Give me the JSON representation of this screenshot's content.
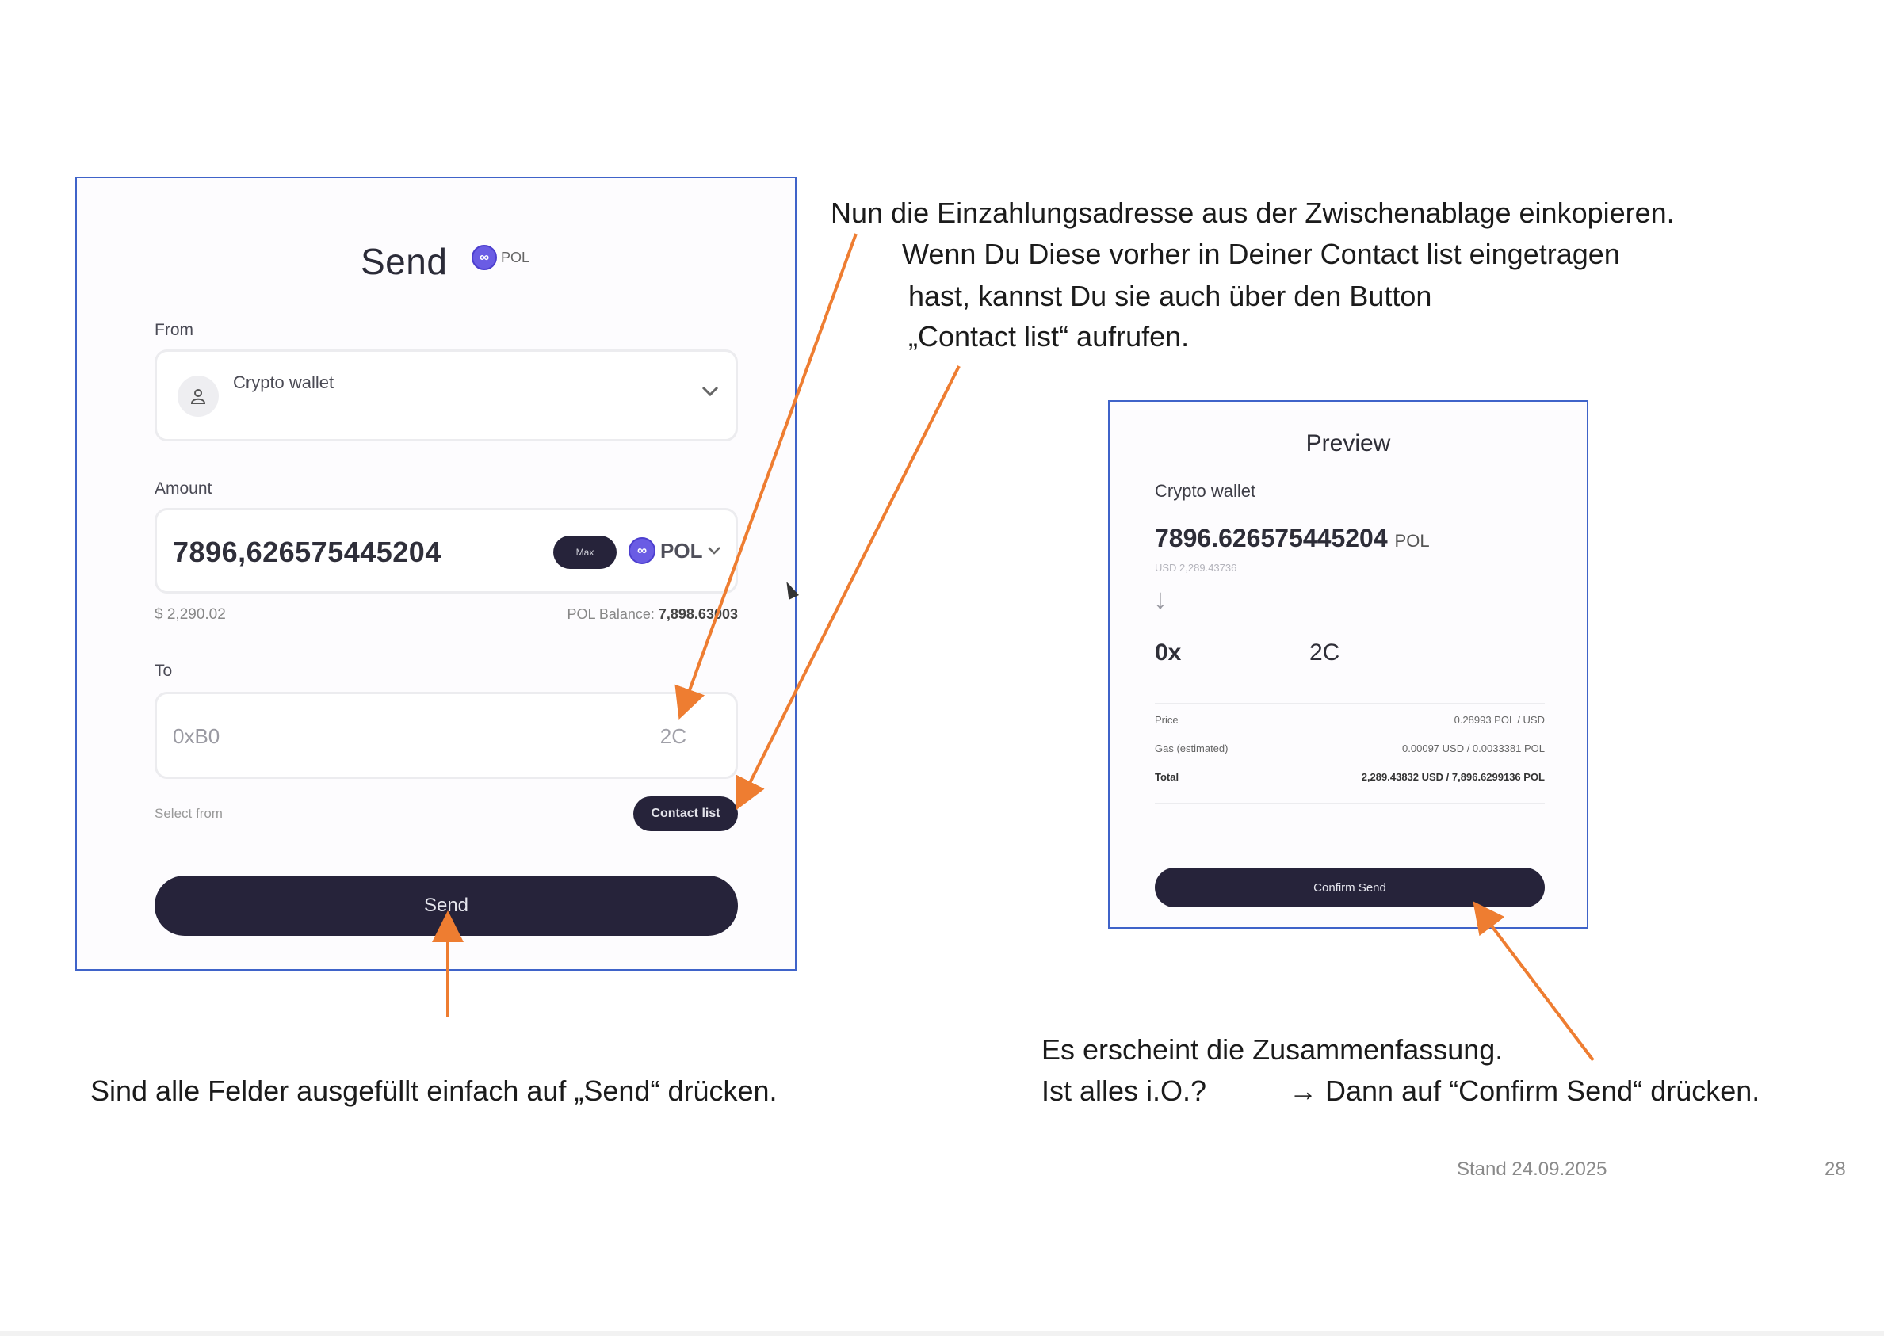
{
  "send_panel": {
    "title": "Send",
    "token": "POL",
    "token_icon": "polygon-icon",
    "from": {
      "label": "From",
      "wallet_name": "Crypto wallet"
    },
    "amount": {
      "label": "Amount",
      "value": "7896,626575445204",
      "max_label": "Max",
      "token": "POL",
      "usd_value": "$ 2,290.02",
      "balance_label": "POL Balance:",
      "balance_value": "7,898.63003"
    },
    "to": {
      "label": "To",
      "address_start": "0xB0",
      "address_end": "2C",
      "select_from_label": "Select from",
      "contact_button_label": "Contact list"
    },
    "send_button_label": "Send"
  },
  "preview_panel": {
    "title": "Preview",
    "wallet_name": "Crypto wallet",
    "amount_value": "7896.626575445204",
    "amount_unit": "POL",
    "usd_value": "USD 2,289.43736",
    "direction_arrow": "↓",
    "address_start": "0x",
    "address_end": "2C",
    "rows": [
      {
        "label": "Price",
        "value": "0.28993 POL / USD"
      },
      {
        "label": "Gas (estimated)",
        "value": "0.00097 USD / 0.0033381 POL"
      },
      {
        "label": "Total",
        "value": "2,289.43832 USD / 7,896.6299136 POL"
      }
    ],
    "confirm_button_label": "Confirm Send"
  },
  "annotations": {
    "paste_line1": "Nun die Einzahlungsadresse aus der Zwischenablage einkopieren.",
    "paste_line2": "Wenn Du Diese vorher in Deiner Contact list eingetragen",
    "paste_line3": "hast, kannst Du sie auch über den Button",
    "paste_line4": "„Contact list“ aufrufen.",
    "send_hint": "Sind alle Felder ausgefüllt einfach auf „Send“ drücken.",
    "summary_line1": "Es erscheint die Zusammenfassung.",
    "summary_line2_a": "Ist alles i.O.?",
    "summary_line2_b": "→ Dann auf “Confirm Send“ drücken."
  },
  "footer": {
    "date": "Stand 24.09.2025",
    "page_number": "28"
  },
  "colors": {
    "arrow": "#ee7d31",
    "panel_border": "#3f63c9",
    "button": "#26233a",
    "token": "#6a5ce4"
  }
}
